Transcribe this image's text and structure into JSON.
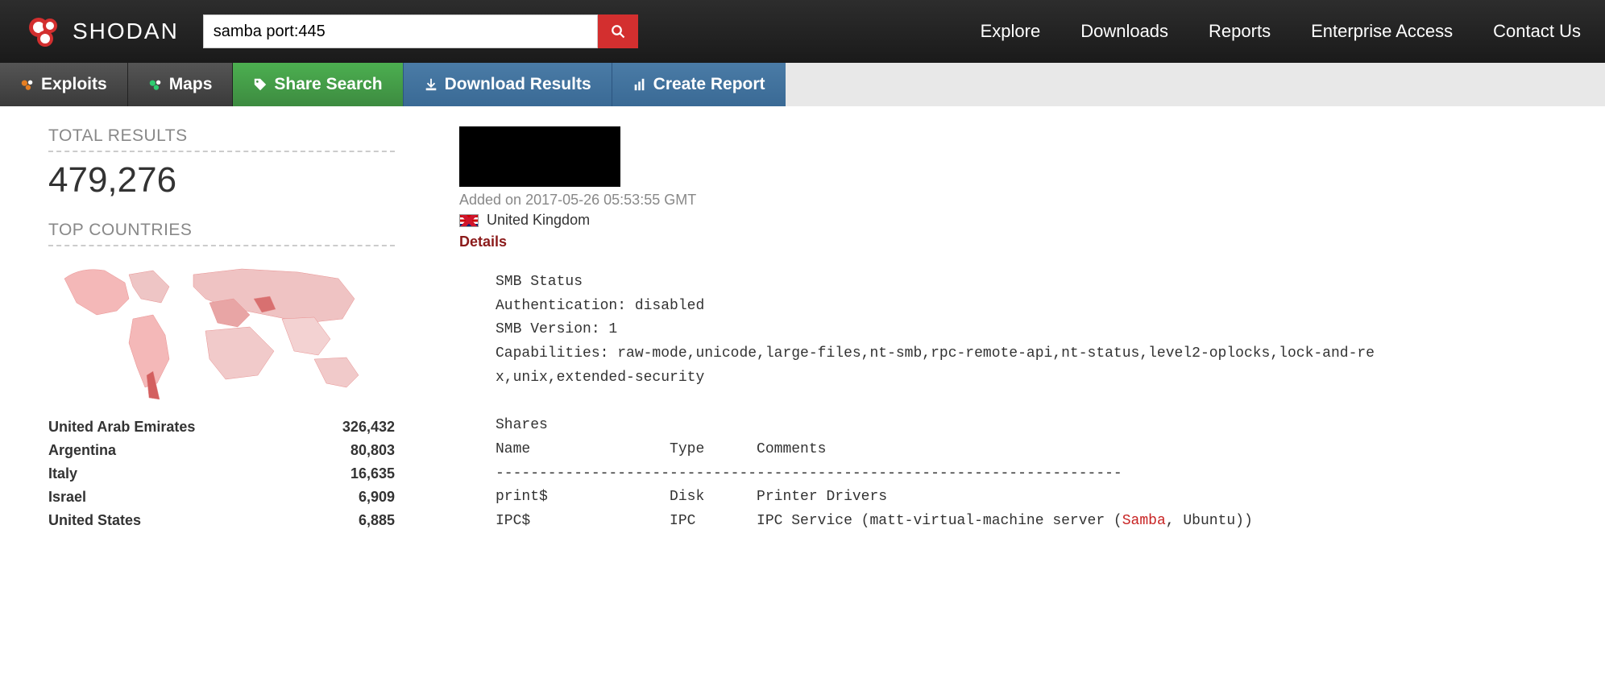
{
  "header": {
    "brand": "SHODAN",
    "search_value": "samba port:445",
    "nav": [
      "Explore",
      "Downloads",
      "Reports",
      "Enterprise Access",
      "Contact Us"
    ]
  },
  "subnav": {
    "exploits": "Exploits",
    "maps": "Maps",
    "share": "Share Search",
    "download": "Download Results",
    "report": "Create Report"
  },
  "sidebar": {
    "total_label": "TOTAL RESULTS",
    "total_value": "479,276",
    "countries_label": "TOP COUNTRIES",
    "countries": [
      {
        "name": "United Arab Emirates",
        "count": "326,432"
      },
      {
        "name": "Argentina",
        "count": "80,803"
      },
      {
        "name": "Italy",
        "count": "16,635"
      },
      {
        "name": "Israel",
        "count": "6,909"
      },
      {
        "name": "United States",
        "count": "6,885"
      }
    ]
  },
  "result": {
    "added": "Added on 2017-05-26 05:53:55 GMT",
    "country": "United Kingdom",
    "details_label": "Details",
    "smb": {
      "status_line": "SMB Status",
      "auth_line": "Authentication: disabled",
      "version_line": "SMB Version: 1",
      "caps_line": "Capabilities: raw-mode,unicode,large-files,nt-smb,rpc-remote-api,nt-status,level2-oplocks,lock-and-re",
      "caps_line2": "x,unix,extended-security",
      "shares_label": "Shares",
      "header_name": "Name",
      "header_type": "Type",
      "header_comments": "Comments",
      "rows": [
        {
          "name": "print$",
          "type": "Disk",
          "comments": "Printer Drivers"
        },
        {
          "name": "IPC$",
          "type": "IPC",
          "comments_prefix": "IPC Service (matt-virtual-machine server (",
          "comments_highlight": "Samba",
          "comments_suffix": ", Ubuntu))"
        }
      ]
    }
  }
}
